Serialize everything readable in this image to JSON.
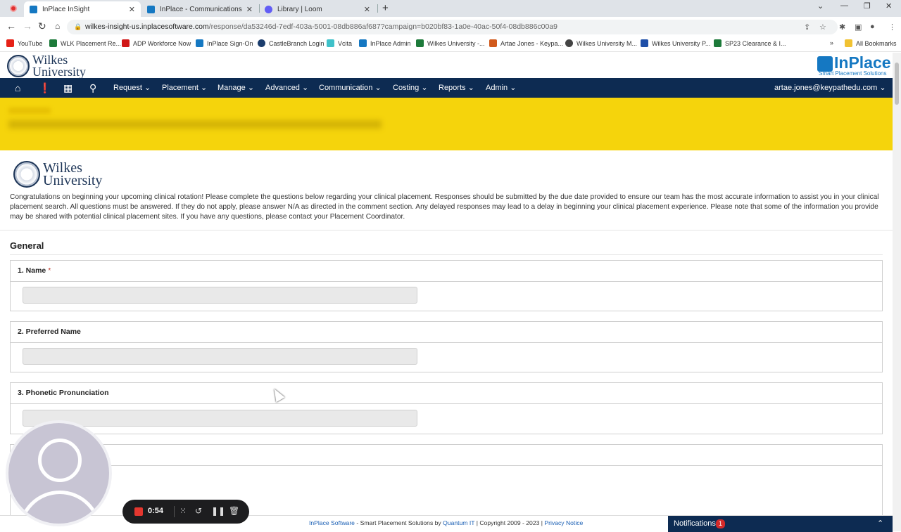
{
  "browser": {
    "tabs": [
      {
        "label": "InPlace InSight",
        "active": true,
        "icon": "inplace-favicon"
      },
      {
        "label": "InPlace - Communications",
        "active": false,
        "icon": "inplace-favicon"
      },
      {
        "label": "Library | Loom",
        "active": false,
        "icon": "loom-favicon"
      }
    ],
    "url_host": "wilkes-insight-us.inplacesoftware.com",
    "url_rest": "/response/da53246d-7edf-403a-5001-08db886af687?campaign=b020bf83-1a0e-40ac-50f4-08db886c00a9",
    "bookmarks": [
      {
        "label": "YouTube",
        "color": "#e62117"
      },
      {
        "label": "WLK Placement Re...",
        "color": "#1d7a3a"
      },
      {
        "label": "ADP Workforce Now",
        "color": "#d01616"
      },
      {
        "label": "InPlace Sign-On",
        "color": "#1578c2"
      },
      {
        "label": "CastleBranch Login",
        "color": "#1b3d6d"
      },
      {
        "label": "Vcita",
        "color": "#3fc1c9"
      },
      {
        "label": "InPlace Admin",
        "color": "#1578c2"
      },
      {
        "label": "Wilkes University -...",
        "color": "#1d7a3a"
      },
      {
        "label": "Artae Jones - Keypa...",
        "color": "#d15a1c"
      },
      {
        "label": "Wilkes University M...",
        "color": "#444444"
      },
      {
        "label": "Wilkes University P...",
        "color": "#1f4fa8"
      },
      {
        "label": "SP23 Clearance & I...",
        "color": "#1d7a3a"
      }
    ],
    "all_bookmarks": "All Bookmarks"
  },
  "header": {
    "logo_line1": "Wilkes",
    "logo_line2": "University",
    "inplace_word": "InPlace",
    "inplace_tag": "Smart Placement Solutions"
  },
  "nav": {
    "items": [
      "Request",
      "Placement",
      "Manage",
      "Advanced",
      "Communication",
      "Costing",
      "Reports",
      "Admin"
    ],
    "user": "artae.jones@keypathedu.com"
  },
  "intro": "Congratulations on beginning your upcoming clinical rotation! Please complete the questions below regarding your clinical placement. Responses should be submitted by the due date provided to ensure our team has the most accurate information to assist you in your clinical placement search.  All questions must be answered. If they do not apply, please answer N/A as directed in the comment section. Any delayed responses may lead to a delay in beginning your clinical placement experience. Please note that some of the information you provide may be shared with potential clinical placement sites. If you have any questions, please contact your Placement Coordinator.",
  "section": "General",
  "questions": [
    {
      "label": "1. Name",
      "required": "*"
    },
    {
      "label": "2. Preferred Name",
      "required": ""
    },
    {
      "label": "3. Phonetic Pronunciation",
      "required": ""
    }
  ],
  "footer": {
    "inplace": "InPlace Software",
    "mid": " - Smart Placement Solutions by ",
    "quantum": "Quantum IT",
    "copy": " | Copyright 2009 - 2023 | ",
    "privacy": "Privacy Notice"
  },
  "notifications": {
    "label": "Notifications",
    "count": "1"
  },
  "recorder": {
    "time": "0:54"
  }
}
